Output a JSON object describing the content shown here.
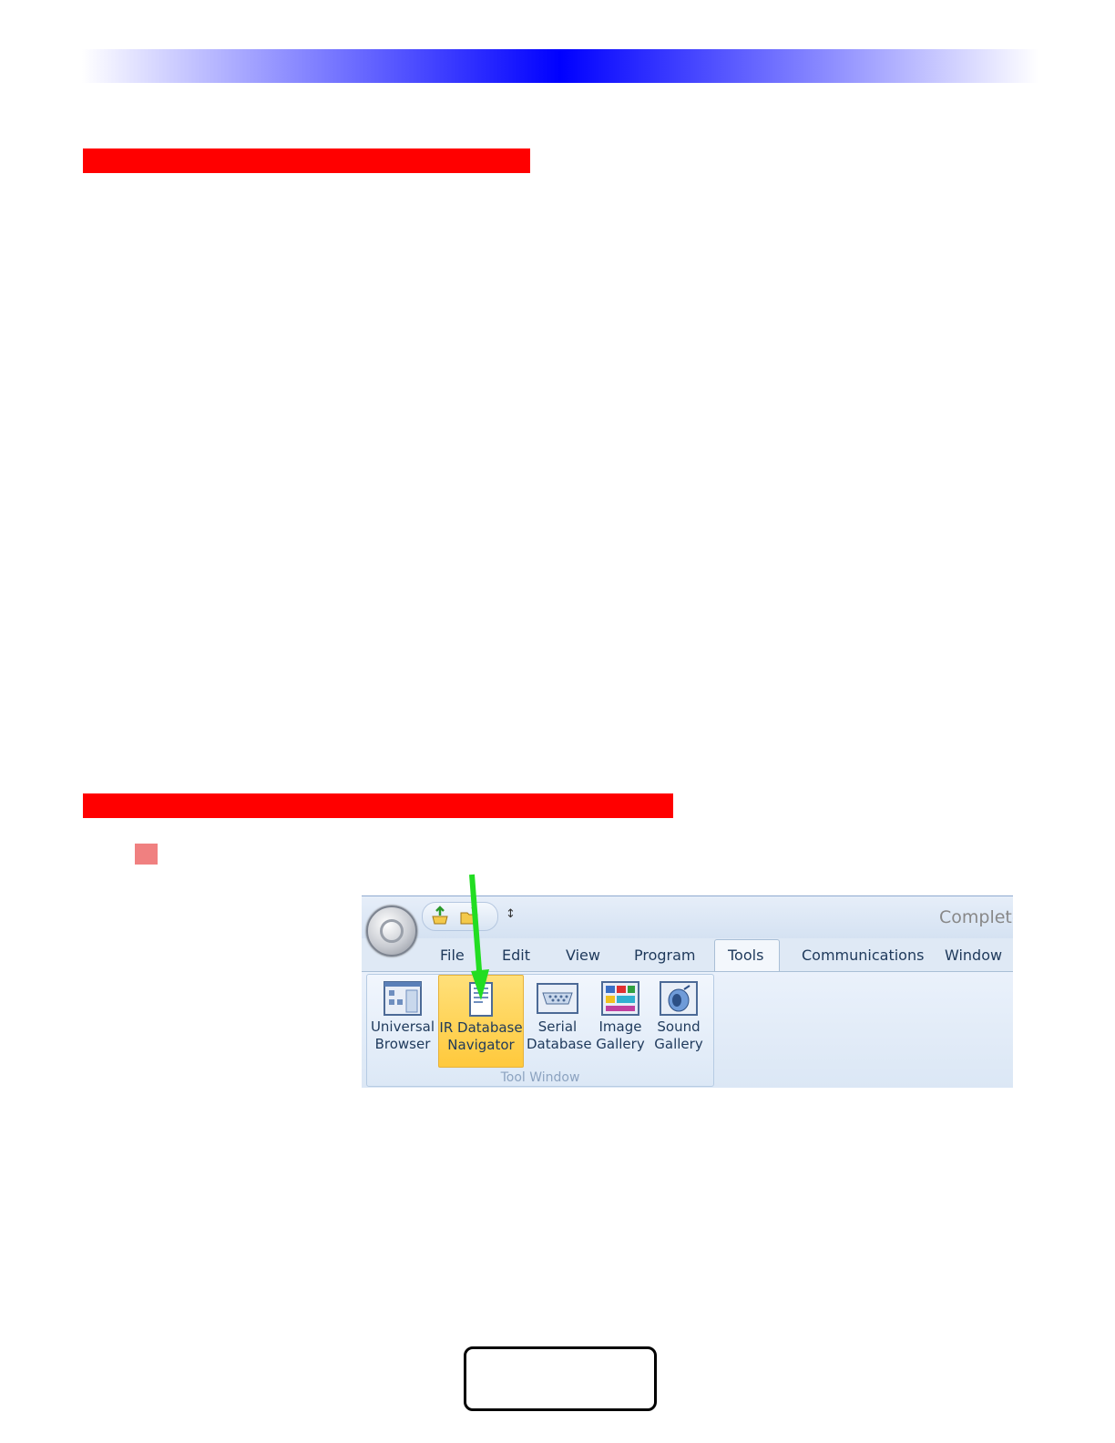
{
  "ribbon": {
    "title": "Complete",
    "qat": {
      "save_icon": "save-icon",
      "open_icon": "open-folder-icon",
      "customize": "↕"
    },
    "tabs": [
      {
        "label": "File"
      },
      {
        "label": "Edit"
      },
      {
        "label": "View"
      },
      {
        "label": "Program"
      },
      {
        "label": "Tools"
      },
      {
        "label": "Communications"
      },
      {
        "label": "Window"
      }
    ],
    "active_tab": "Tools",
    "group": {
      "label": "Tool Window",
      "tools": [
        {
          "line1": "Universal",
          "line2": "Browser",
          "icon": "universal-browser-icon"
        },
        {
          "line1": "IR Database",
          "line2": "Navigator",
          "icon": "ir-database-navigator-icon",
          "highlighted": true
        },
        {
          "line1": "Serial",
          "line2": "Database",
          "icon": "serial-database-icon"
        },
        {
          "line1": "Image",
          "line2": "Gallery",
          "icon": "image-gallery-icon"
        },
        {
          "line1": "Sound",
          "line2": "Gallery",
          "icon": "sound-gallery-icon"
        }
      ]
    }
  },
  "colors": {
    "heading_bar": "#ff0000",
    "top_gradient_center": "#0000ff",
    "bullet": "#f08080",
    "arrow": "#22dd22",
    "highlight": "#ffc93c"
  }
}
